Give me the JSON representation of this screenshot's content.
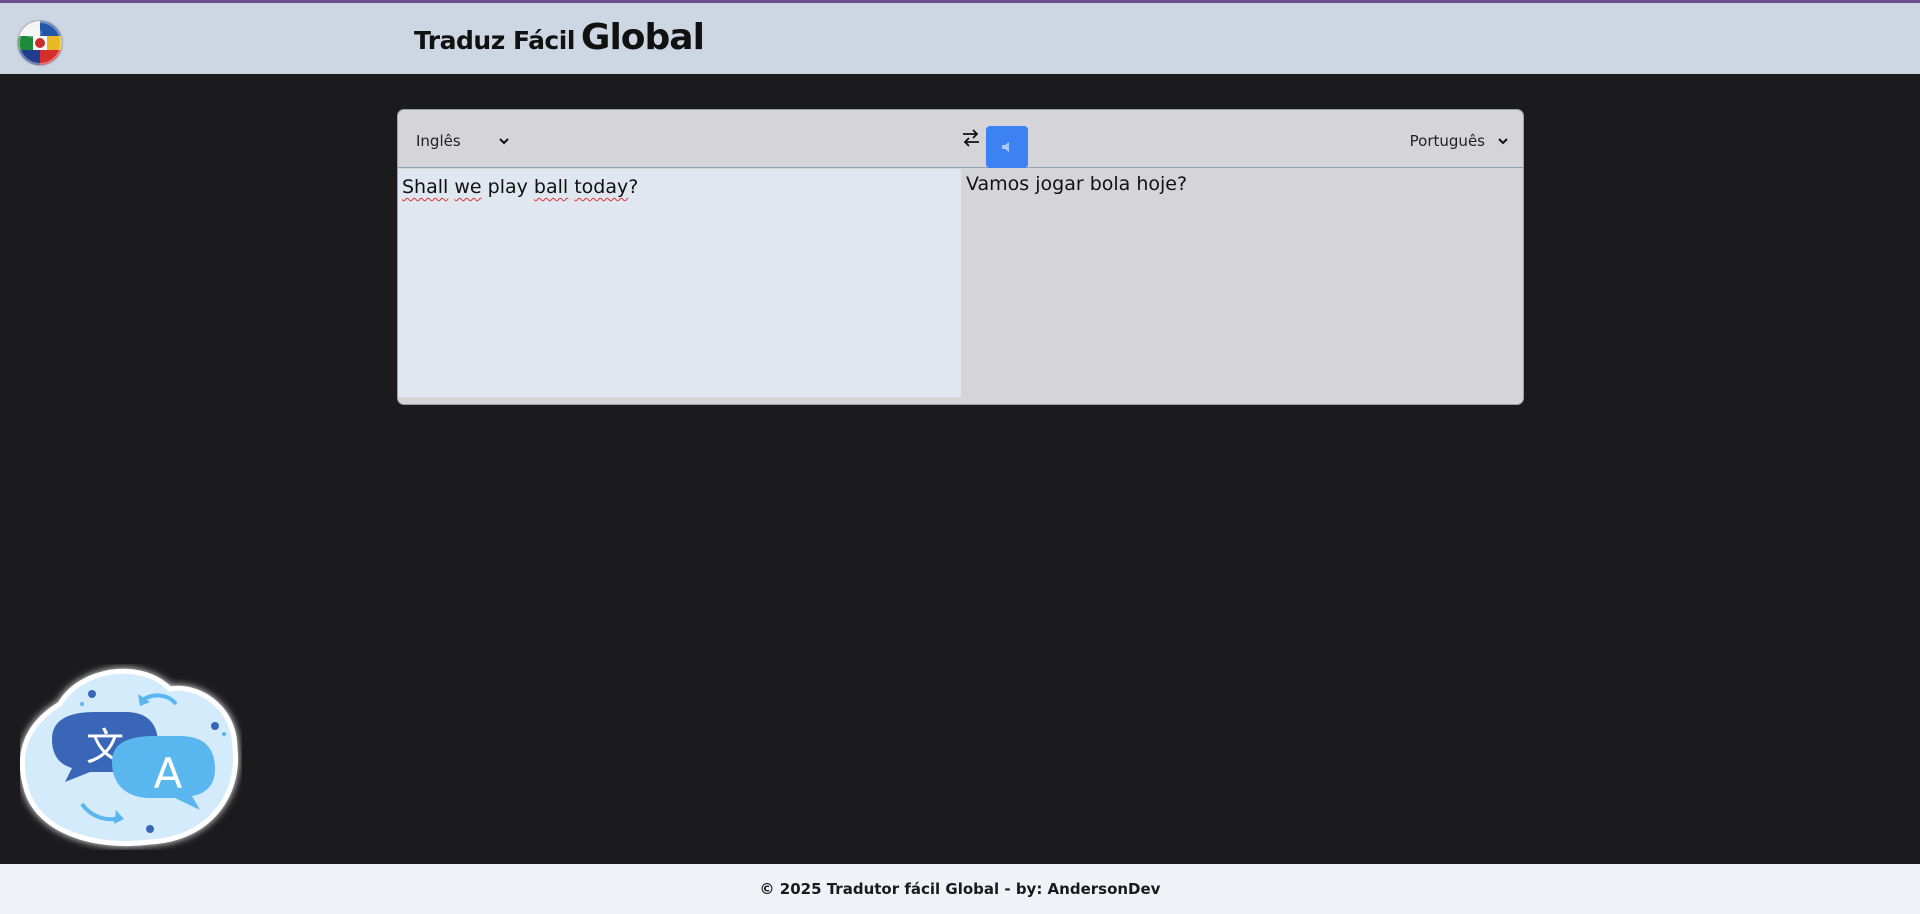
{
  "header": {
    "brand_small": "Traduz Fácil",
    "brand_big": "Global",
    "logo_icon": "flags-globe-icon"
  },
  "translator": {
    "source_language": "Inglês",
    "target_language": "Português",
    "swap_icon": "swap-arrows-icon",
    "speak_icon": "speaker-icon",
    "source_text": "Shall we play ball today?",
    "translated_text": "Vamos jogar bola hoje?",
    "colors": {
      "panel": "#d5d4d8",
      "source_area": "#e0e7f0",
      "speak_button": "#3c82f2"
    }
  },
  "illustration": {
    "icon": "translate-bubbles-icon",
    "glyph_left": "文",
    "glyph_right": "A"
  },
  "footer": {
    "text": "© 2025 Tradutor fácil Global - by: AndersonDev"
  },
  "colors": {
    "page_bg": "#1b1b1d",
    "header_bg": "#cdd7e3",
    "footer_bg": "#eff3f7"
  }
}
